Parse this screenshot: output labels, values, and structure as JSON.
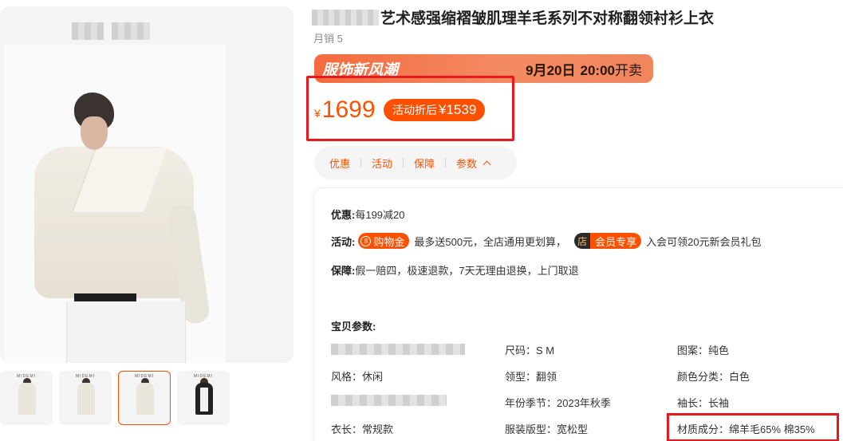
{
  "product": {
    "title": "艺术感强缩褶皱肌理羊毛系列不对称翻领衬衫上衣",
    "sales": "月销 5"
  },
  "promo": {
    "title": "服饰新风潮",
    "date": "9月20日",
    "time": "20:00",
    "suffix": "开卖"
  },
  "price": {
    "currency": "¥",
    "amount": "1699",
    "discount_label": "活动折后",
    "discount_value": "¥1539"
  },
  "tabs": [
    "优惠",
    "活动",
    "保障",
    "参数"
  ],
  "details": {
    "youhui_label": "优惠:",
    "youhui_text": "每199减20",
    "huodong_label": "活动:",
    "gouwujin_badge": "购物金",
    "gouwujin_coin": "8",
    "gouwujin_text": "最多送500元，全店通用更划算，",
    "store_badge": "店",
    "vip_badge": "会员专享",
    "vip_text": "入会可领20元新会员礼包",
    "baozhang_label": "保障:",
    "baozhang_text": "假一赔四，极速退款，7天无理由退换，上门取退"
  },
  "params": {
    "title": "宝贝参数:",
    "items": [
      "尺码：S M",
      "图案：纯色",
      "风格：休闲",
      "领型：翻领",
      "颜色分类：白色",
      "年份季节：2023年秋季",
      "袖长：长袖",
      "衣长：常规款",
      "服装版型：宽松型",
      "材质成分：绵羊毛65% 棉35%"
    ]
  },
  "thumbnail_brand": "MIDEMI",
  "colors": {
    "accent": "#ff5000",
    "highlight_box": "#e8181e",
    "promo_banner": "#f46a3e"
  }
}
